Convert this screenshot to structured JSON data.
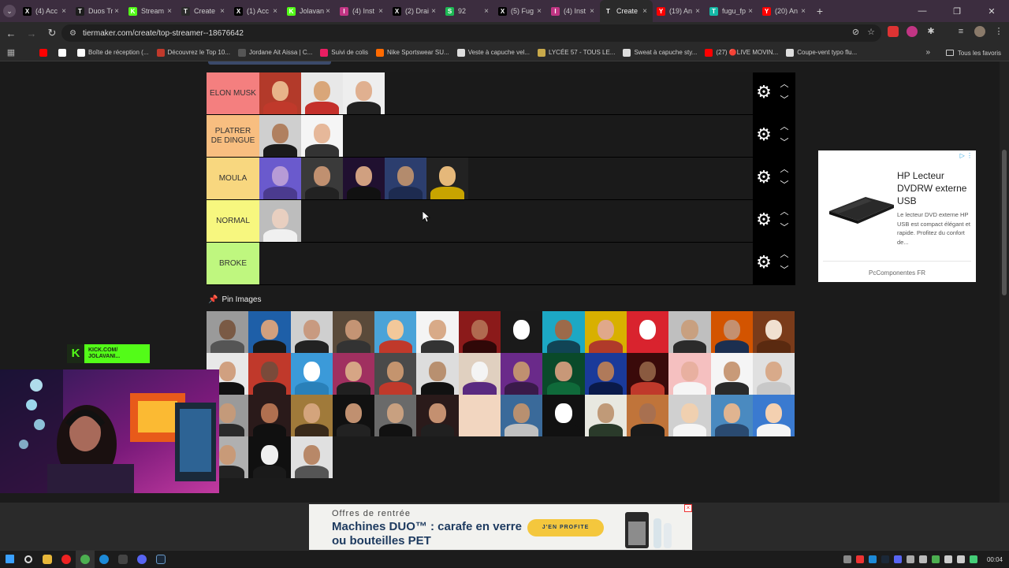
{
  "tabs": [
    {
      "title": "(4) Acc",
      "fav": "X",
      "color": "#000000"
    },
    {
      "title": "Duos Tr",
      "fav": "T",
      "color": "#1d1d1d"
    },
    {
      "title": "Stream",
      "fav": "K",
      "color": "#53fc18"
    },
    {
      "title": "Create",
      "fav": "T",
      "color": "#2b2b2b"
    },
    {
      "title": "(1) Acc",
      "fav": "X",
      "color": "#000000"
    },
    {
      "title": "Jolavan",
      "fav": "K",
      "color": "#53fc18"
    },
    {
      "title": "(4) Inst",
      "fav": "I",
      "color": "#c13584"
    },
    {
      "title": "(2) Drai",
      "fav": "X",
      "color": "#000000"
    },
    {
      "title": "92",
      "fav": "S",
      "color": "#1db954"
    },
    {
      "title": "(5) Fug",
      "fav": "X",
      "color": "#000000"
    },
    {
      "title": "(4) Inst",
      "fav": "I",
      "color": "#c13584"
    },
    {
      "title": "Create",
      "fav": "T",
      "color": "#2b2b2b",
      "active": true
    },
    {
      "title": "(19) An",
      "fav": "Y",
      "color": "#ff0000"
    },
    {
      "title": "fugu_fp",
      "fav": "T",
      "color": "#14b8a6"
    },
    {
      "title": "(20) An",
      "fav": "Y",
      "color": "#ff0000"
    }
  ],
  "address": {
    "url": "tiermaker.com/create/top-streamer--18676642"
  },
  "bookmarks": [
    {
      "label": "",
      "color": "#ff0000"
    },
    {
      "label": "",
      "color": "#ffffff"
    },
    {
      "label": "Boîte de réception (...",
      "color": "#ffffff"
    },
    {
      "label": "Découvrez le Top 10...",
      "color": "#c0392b"
    },
    {
      "label": "Jordane Ait Aissa | C...",
      "color": "#555555"
    },
    {
      "label": "Suivi de colis",
      "color": "#e91e63"
    },
    {
      "label": "Nike Sportswear SU...",
      "color": "#ff6a00"
    },
    {
      "label": "Veste à capuche vel...",
      "color": "#dddddd"
    },
    {
      "label": "LYCÉE 57 - TOUS LE...",
      "color": "#c8a94a"
    },
    {
      "label": "Sweat à capuche sty...",
      "color": "#dddddd"
    },
    {
      "label": "(27) 🔴LIVE MOVIN...",
      "color": "#ff0000"
    },
    {
      "label": "Coupe-vent typo flu...",
      "color": "#dddddd"
    }
  ],
  "all_bookmarks_label": "Tous les favoris",
  "tiers": [
    {
      "label": "ELON MUSK",
      "color": "#f47f7f",
      "items": [
        {
          "bg": "#b33a2a",
          "face": "#e8b48a",
          "body": "#c0392b"
        },
        {
          "bg": "#e8e8e8",
          "face": "#d9a679",
          "body": "#c4302b"
        },
        {
          "bg": "#eeeeee",
          "face": "#e0b090",
          "body": "#222222"
        }
      ]
    },
    {
      "label": "PLATRER DE DINGUE",
      "color": "#f8be80",
      "items": [
        {
          "bg": "#cfcfcf",
          "face": "#b08060",
          "body": "#1a1a1a"
        },
        {
          "bg": "#f5f5f5",
          "face": "#e6b89a",
          "body": "#333333"
        }
      ]
    },
    {
      "label": "MOULA",
      "color": "#f8d77f",
      "items": [
        {
          "bg": "#6a5acd",
          "face": "#b79bd6",
          "body": "#4b3b8f"
        },
        {
          "bg": "#3a3a3a",
          "face": "#c09070",
          "body": "#222222"
        },
        {
          "bg": "#201030",
          "face": "#d0a080",
          "body": "#111111"
        },
        {
          "bg": "#2c3e6e",
          "face": "#b38b6d",
          "body": "#1d2b50"
        },
        {
          "bg": "#222222",
          "face": "#e5b87a",
          "body": "#c8a400"
        }
      ]
    },
    {
      "label": "NORMAL",
      "color": "#f7f77f",
      "items": [
        {
          "bg": "#bdbdbd",
          "face": "#e8cfc0",
          "body": "#f0f0f0"
        }
      ]
    },
    {
      "label": "BROKE",
      "color": "#bff77f",
      "items": []
    }
  ],
  "pin_label": "Pin Images",
  "pool": [
    {
      "bg": "#9a9a9a",
      "face": "#7a5a45",
      "body": "#555555"
    },
    {
      "bg": "#1e5fa8",
      "face": "#d2a07e",
      "body": "#1a1a1a"
    },
    {
      "bg": "#cfcfcf",
      "face": "#c89a80",
      "body": "#222222"
    },
    {
      "bg": "#5a4a3a",
      "face": "#c49474",
      "body": "#333333"
    },
    {
      "bg": "#4aa3d8",
      "face": "#f2c89a",
      "body": "#c0392b"
    },
    {
      "bg": "#f4f4f4",
      "face": "#d8aa88",
      "body": "#333333"
    },
    {
      "bg": "#8b1a1a",
      "face": "#b06a50",
      "body": "#300808"
    },
    {
      "bg": "#1a1a1a",
      "face": "#ffffff",
      "body": "#1a1a1a"
    },
    {
      "bg": "#1ca8c4",
      "face": "#9c6a4a",
      "body": "#114455"
    },
    {
      "bg": "#d8b000",
      "face": "#e0a88a",
      "body": "#b03a2a"
    },
    {
      "bg": "#d9232e",
      "face": "#ffffff",
      "body": "#d9232e"
    },
    {
      "bg": "#bfbfbf",
      "face": "#c8a080",
      "body": "#2b2b2b"
    },
    {
      "bg": "#d35400",
      "face": "#c49070",
      "body": "#1c2f50"
    },
    {
      "bg": "#7a3b1a",
      "face": "#f0e0d0",
      "body": "#5a2a10"
    },
    {
      "bg": "#e8e8e8",
      "face": "#d0a080",
      "body": "#111111"
    },
    {
      "bg": "#c0392b",
      "face": "#7a4a3a",
      "body": "#2a1a1a"
    },
    {
      "bg": "#3b9ad9",
      "face": "#ffffff",
      "body": "#2980b9"
    },
    {
      "bg": "#a03060",
      "face": "#d6a585",
      "body": "#202020"
    },
    {
      "bg": "#4a4a4a",
      "face": "#c4946e",
      "body": "#c0392b"
    },
    {
      "bg": "#dddddd",
      "face": "#b89070",
      "body": "#111111"
    },
    {
      "bg": "#e0d0c0",
      "face": "#f4f4f4",
      "body": "#5a2a80"
    },
    {
      "bg": "#6a2a8a",
      "face": "#c09070",
      "body": "#3a1a4a"
    },
    {
      "bg": "#0a4a2a",
      "face": "#c89878",
      "body": "#0f6a3a"
    },
    {
      "bg": "#1a3a9a",
      "face": "#b07a5a",
      "body": "#0a1a4a"
    },
    {
      "bg": "#3a0a0a",
      "face": "#8a5a40",
      "body": "#c0392b"
    },
    {
      "bg": "#f5c0c0",
      "face": "#e8b0a0",
      "body": "#f5f5f5"
    },
    {
      "bg": "#f5f5f5",
      "face": "#c89a78",
      "body": "#2a2a2a"
    },
    {
      "bg": "#e0e0e0",
      "face": "#d8aa8a",
      "body": "#c8c8c8"
    },
    {
      "bg": "#9a9a9a",
      "face": "#c49a7a",
      "body": "#2a2a2a"
    },
    {
      "bg": "#2a1a1a",
      "face": "#b07050",
      "body": "#101010"
    },
    {
      "bg": "#a07a3a",
      "face": "#d4a47c",
      "body": "#3a2a1a"
    },
    {
      "bg": "#111111",
      "face": "#c09070",
      "body": "#222222"
    },
    {
      "bg": "#6a6a6a",
      "face": "#c8a080",
      "body": "#111111"
    },
    {
      "bg": "#2a1a1a",
      "face": "#c49070",
      "body": "#202020"
    },
    {
      "bg": "#f2d6c0",
      "face": "#f2d6c0",
      "body": "#f2d6c0"
    },
    {
      "bg": "#3a6a9a",
      "face": "#b89070",
      "body": "#c0c0c0"
    },
    {
      "bg": "#111111",
      "face": "#ffffff",
      "body": "#111111"
    },
    {
      "bg": "#e8e8e0",
      "face": "#c09a78",
      "body": "#2a3a2a"
    },
    {
      "bg": "#c0743a",
      "face": "#a87050",
      "body": "#1a1a1a"
    },
    {
      "bg": "#d0d0d0",
      "face": "#f0d0b0",
      "body": "#f5f5f5"
    },
    {
      "bg": "#4a8ac0",
      "face": "#e0b490",
      "body": "#2a4a70"
    },
    {
      "bg": "#3a7ad0",
      "face": "#f4d0b0",
      "body": "#f5f5f5"
    },
    {
      "bg": "#b0b0b0",
      "face": "#c89a78",
      "body": "#222222"
    },
    {
      "bg": "#101010",
      "face": "#f0f0f0",
      "body": "#1a1a1a"
    },
    {
      "bg": "#e0e0e0",
      "face": "#b88868",
      "body": "#555555"
    }
  ],
  "ad_right": {
    "title": "HP Lecteur DVDRW externe USB",
    "desc": "Le lecteur DVD externe HP USB est compact élégant et rapide. Profitez du confort de...",
    "source": "PcComponentes FR"
  },
  "ad_bottom": {
    "subtitle": "Offres de rentrée",
    "title": "Machines DUO™ : carafe en verre ou bouteilles PET",
    "button": "J'EN PROFITE"
  },
  "overlay": {
    "kick_line1": "KICK.COM/",
    "kick_line2": "JOLAVANI..."
  },
  "taskbar": {
    "clock": "00:04"
  }
}
